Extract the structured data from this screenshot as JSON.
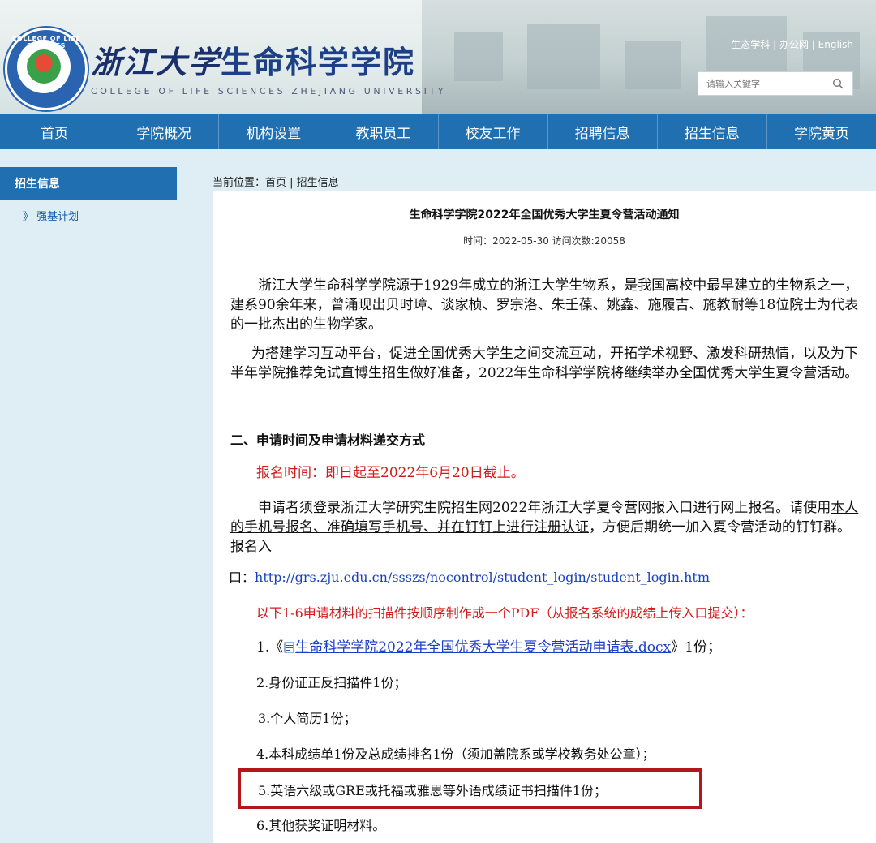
{
  "header": {
    "cn_title_script": "浙江大学",
    "cn_title_main": "生命科学学院",
    "en_title": "COLLEGE OF LIFE SCIENCES ZHEJIANG UNIVERSITY",
    "logo_text": "COLLEGE OF LIFE SCIENCES",
    "top_links": [
      "生态学科",
      "办公网",
      "English"
    ],
    "search_placeholder": "请输入关键字",
    "search_icon": "magnifier-icon"
  },
  "nav": [
    "首页",
    "学院概况",
    "机构设置",
    "教职员工",
    "校友工作",
    "招聘信息",
    "招生信息",
    "学院黄页"
  ],
  "sidebar": {
    "title": "招生信息",
    "item_prefix": "》",
    "item": "强基计划"
  },
  "breadcrumb": "当前位置：首页 | 招生信息",
  "article": {
    "title": "生命科学学院2022年全国优秀大学生夏令营活动通知",
    "meta": "时间：2022-05-30 访问次数:20058",
    "p1": "浙江大学生命科学学院源于1929年成立的浙江大学生物系，是我国高校中最早建立的生物系之一，建系90余年来，曾涌现出贝时璋、谈家桢、罗宗洛、朱壬葆、姚鑫、施履吉、施教耐等18位院士为代表的一批杰出的生物学家。",
    "p2": "为搭建学习互动平台，促进全国优秀大学生之间交流互动，开拓学术视野、激发科研热情，以及为下半年学院推荐免试直博生招生做好准备，2022年生命科学学院将继续举办全国优秀大学生夏令营活动。",
    "section2": "二、申请时间及申请材料递交方式",
    "deadline": "报名时间：即日起至2022年6月20日截止。",
    "reg_a": "申请者须登录浙江大学研究生院招生网2022年浙江大学夏令营网报入口进行网上报名。请使用",
    "reg_u": "本人的手机号报名、准确填写手机号、并在钉钉上进行注册认证",
    "reg_b": "，方便后期统一加入夏令营活动的钉钉群。报名入",
    "reg_c": "口：",
    "reg_link": "http://grs.zju.edu.cn/ssszs/nocontrol/student_login/student_login.htm",
    "materials_intro": "以下1-6申请材料的扫描件按顺序制作成一个PDF（从报名系统的成绩上传入口提交）：",
    "item1_pre": "1.《",
    "item1_link": "生命科学学院2022年全国优秀大学生夏令营活动申请表.docx",
    "item1_post": "》1份；",
    "item2": "2.身份证正反扫描件1份；",
    "item3": "3.个人简历1份；",
    "item4": "4.本科成绩单1份及总成绩排名1份（须加盖院系或学校教务处公章）；",
    "item5": "5.英语六级或GRE或托福或雅思等外语成绩证书扫描件1份；",
    "item6": "6.其他获奖证明材料。"
  },
  "colors": {
    "nav_blue": "#1f6fb1",
    "highlight_red": "#b3161b",
    "deadline_red": "#d21b1b",
    "link_blue": "#1b3fc4"
  }
}
